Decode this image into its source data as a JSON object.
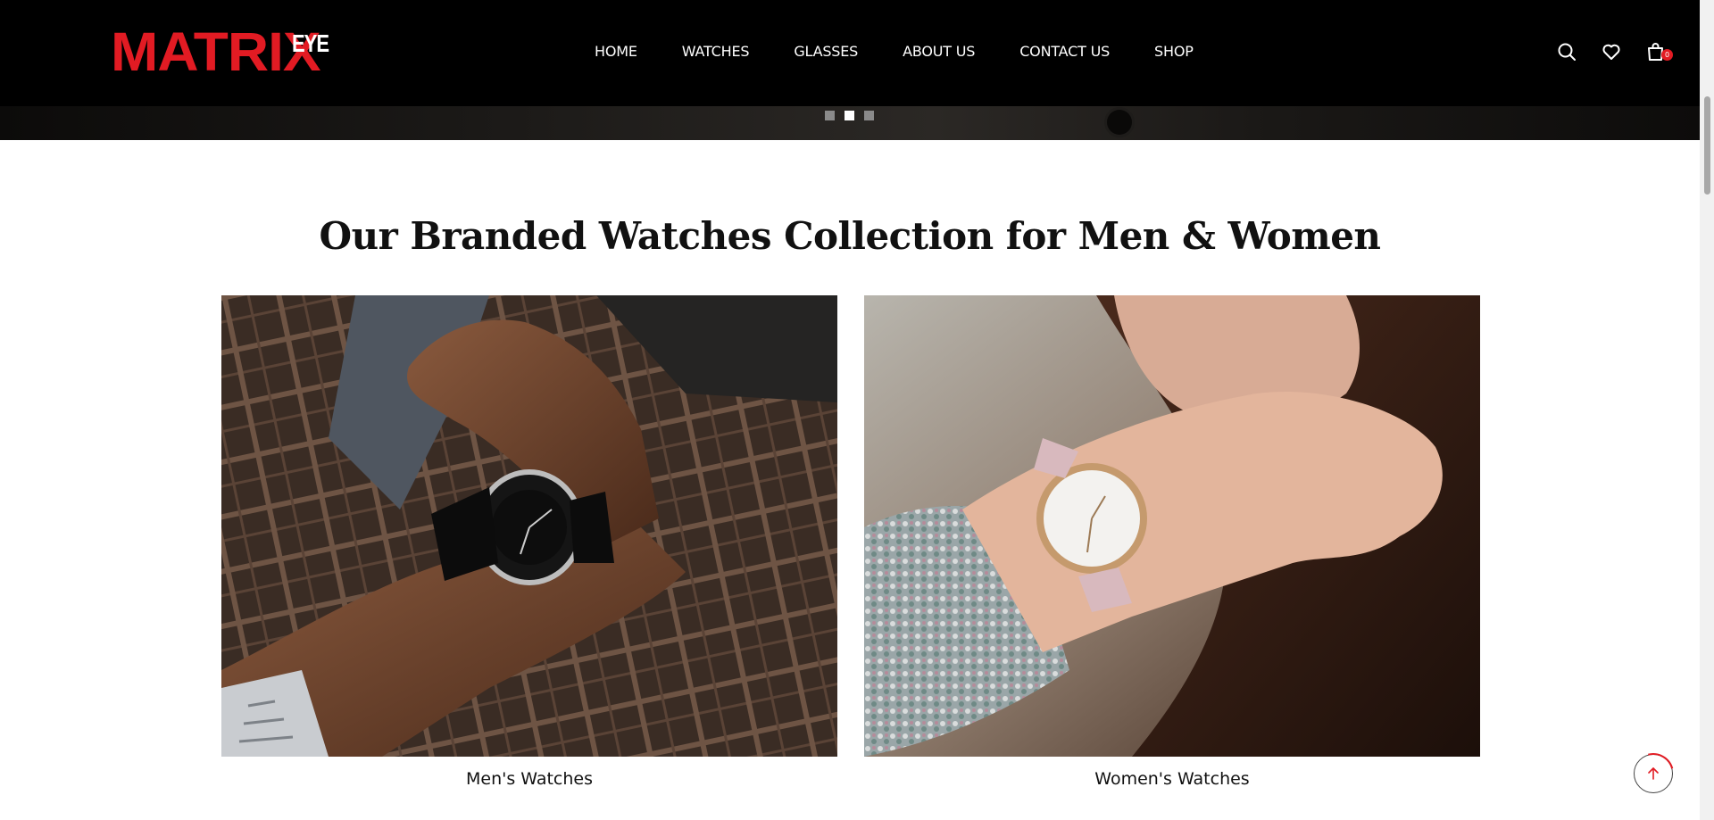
{
  "header": {
    "logo_main": "MATRIX",
    "logo_sub": "EYE",
    "nav": [
      "HOME",
      "WATCHES",
      "GLASSES",
      "ABOUT US",
      "CONTACT US",
      "SHOP"
    ],
    "cart_count": "0",
    "icons": [
      "search-icon",
      "heart-icon",
      "cart-icon"
    ]
  },
  "slider": {
    "dots": 3,
    "active_dot": 2
  },
  "section": {
    "title": "Our Branded Watches Collection for Men & Women",
    "cards": [
      {
        "label": "Men's Watches",
        "image": "man-wearing-black-watch"
      },
      {
        "label": "Women's Watches",
        "image": "woman-wearing-rose-gold-watch"
      }
    ]
  },
  "colors": {
    "brand": "#e21b23",
    "header_bg": "#000000",
    "text": "#111111"
  }
}
